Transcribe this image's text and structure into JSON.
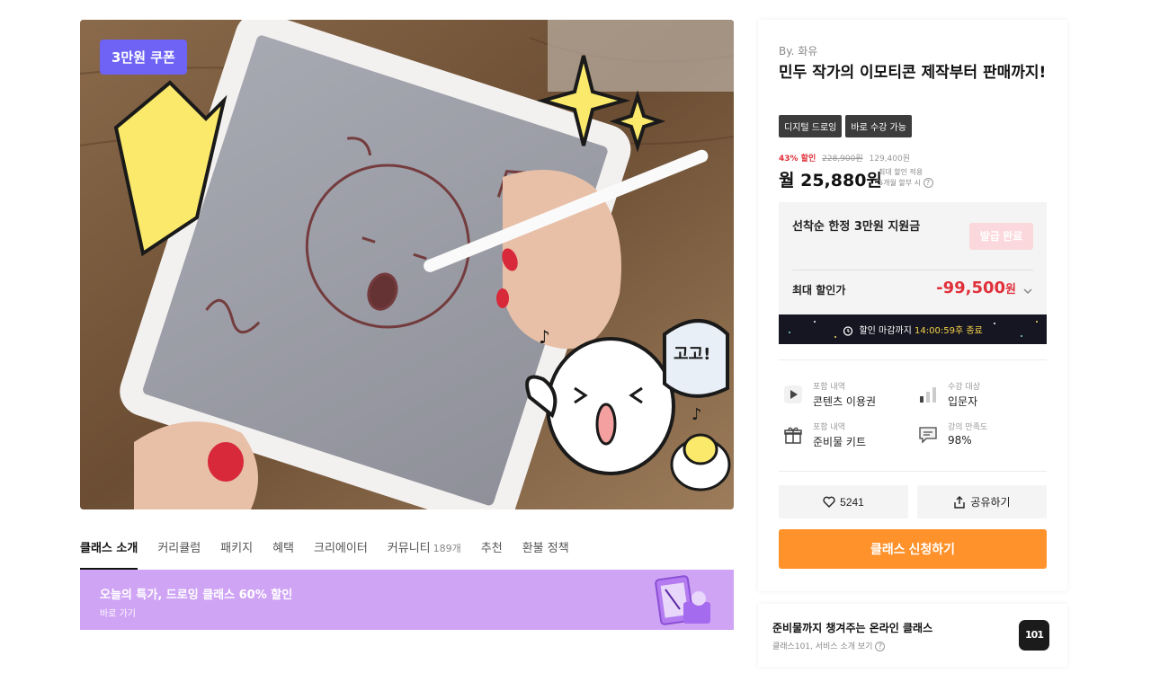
{
  "hero": {
    "coupon_badge": "3만원 쿠폰",
    "image_alt": "iPad drawing with emoticon characters",
    "drawing_text": "고고!"
  },
  "tabs": [
    {
      "label": "클래스 소개",
      "count": "",
      "active": true
    },
    {
      "label": "커리큘럼",
      "count": "",
      "active": false
    },
    {
      "label": "패키지",
      "count": "",
      "active": false
    },
    {
      "label": "혜택",
      "count": "",
      "active": false
    },
    {
      "label": "크리에이터",
      "count": "",
      "active": false
    },
    {
      "label": "커뮤니티",
      "count": "189개",
      "active": false
    },
    {
      "label": "추천",
      "count": "",
      "active": false
    },
    {
      "label": "환불 정책",
      "count": "",
      "active": false
    }
  ],
  "promo": {
    "title": "오늘의 특가, 드로잉 클래스 60% 할인",
    "link": "바로 가기",
    "bg_color": "#cfa4f5"
  },
  "class": {
    "author": "By. 화유",
    "title": "민두 작가의 이모티콘 제작부터 판매까지!",
    "tags": [
      "디지털 드로잉",
      "바로 수강 가능"
    ]
  },
  "price": {
    "discount": "43% 할인",
    "strike_price": "228,900원",
    "orig_price": "129,400원",
    "monthly": "월 25,880원",
    "note_line1": "최대 할인 적용",
    "note_line2": "5개월 할부 시"
  },
  "coupon": {
    "title": "선착순 한정 3만원 지원금",
    "button": "발급 완료",
    "max_label": "최대 할인가",
    "max_value": "-99,500",
    "max_unit": "원",
    "timer_label": "할인 마감까지",
    "timer_time": "14:00:59",
    "timer_suffix": "후 종료"
  },
  "info": [
    {
      "icon": "play-icon",
      "label": "포함 내역",
      "value": "콘텐츠 이용권"
    },
    {
      "icon": "level-bars-icon",
      "label": "수강 대상",
      "value": "입문자"
    },
    {
      "icon": "gift-icon",
      "label": "포함 내역",
      "value": "준비물 키트"
    },
    {
      "icon": "chat-icon",
      "label": "강의 만족도",
      "value": "98%"
    }
  ],
  "actions": {
    "like_count": "5241",
    "share": "공유하기",
    "apply": "클래스 신청하기"
  },
  "service": {
    "title": "준비물까지 챙겨주는 온라인 클래스",
    "sub": "클래스101, 서비스 소개 보기",
    "logo": "101"
  },
  "colors": {
    "accent_orange": "#ff922b",
    "discount_red": "#e0313b",
    "badge_purple": "#6e63f4"
  }
}
